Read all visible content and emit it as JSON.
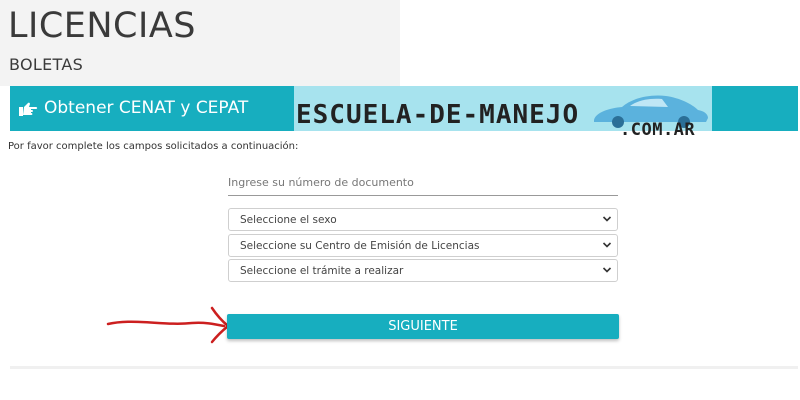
{
  "header": {
    "title": "LICENCIAS",
    "subtitle": "BOLETAS"
  },
  "section": {
    "title": "Obtener CENAT y CEPAT",
    "icon": "hand-pointing-right-icon"
  },
  "watermark": {
    "text": "ESCUELA-DE-MANEJO",
    "domain": ".COM.AR",
    "icon": "car-icon"
  },
  "form": {
    "instructions": "Por favor complete los campos solicitados a continuación:",
    "document_placeholder": "Ingrese su número de documento",
    "selects": [
      {
        "label": "Seleccione el sexo"
      },
      {
        "label": "Seleccione su Centro de Emisión de Licencias"
      },
      {
        "label": "Seleccione el trámite a realizar"
      }
    ],
    "submit_label": "SIGUIENTE"
  },
  "colors": {
    "accent": "#17aebf",
    "watermark_bg": "#a7e3ee",
    "arrow": "#cc1f1f"
  }
}
